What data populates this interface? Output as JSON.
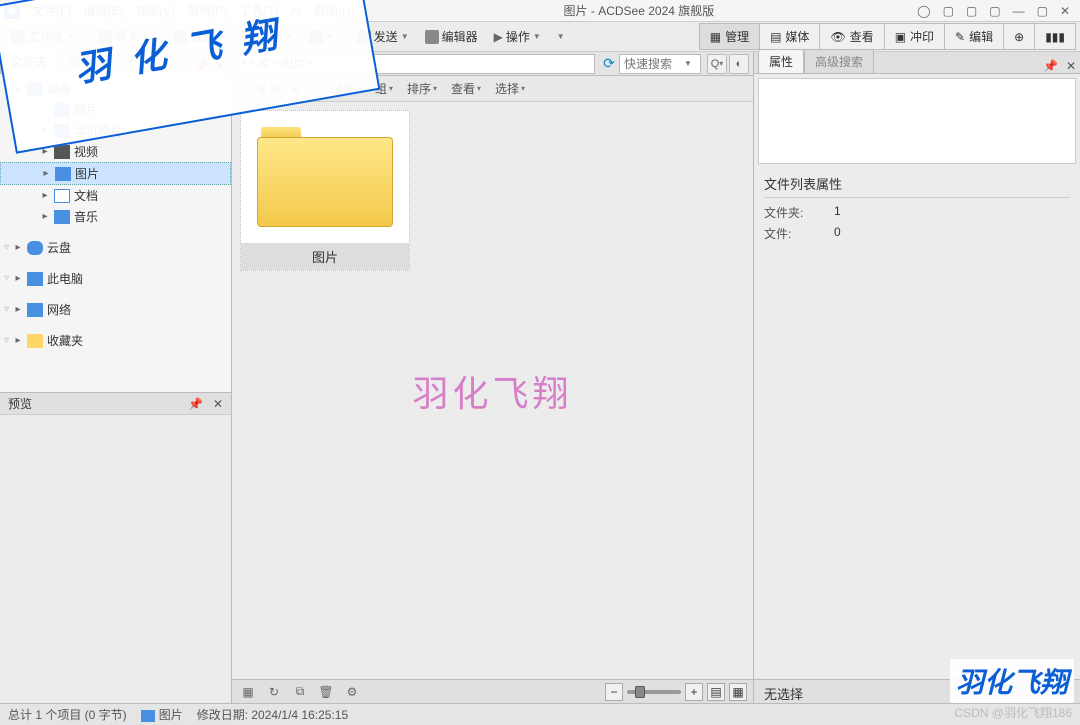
{
  "app": {
    "title": "图片 - ACDSee 2024 旗舰版"
  },
  "menu": {
    "file": "文件(F)",
    "edit": "编辑(E)",
    "view": "视图(V)",
    "pane": "窗格(P)",
    "tools": "工具(T)",
    "ai": "AI",
    "help": "帮助(H)"
  },
  "toolbar": {
    "workspace": "工作区",
    "import": "导入",
    "batch": "批量",
    "create": "创建",
    "send": "发送",
    "editor": "编辑器",
    "operate": "操作"
  },
  "modes": {
    "manage": "管理",
    "media": "媒体",
    "view": "查看",
    "develop": "冲印",
    "edit": "编辑"
  },
  "leftTabs": {
    "folder": "文件夹",
    "catalog": "编目",
    "calendar": "日历"
  },
  "tree": {
    "desktop": "桌面",
    "photos": "本机照片",
    "video": "视频",
    "pictures": "图片",
    "documents": "文档",
    "music": "音乐",
    "cloud": "云盘",
    "thispc": "此电脑",
    "network": "网络",
    "favorites": "收藏夹",
    "picsub": "图片"
  },
  "preview": {
    "title": "预览"
  },
  "breadcrumb": {
    "lib": "库",
    "pics": "图片"
  },
  "search": {
    "placeholder": "快速搜索"
  },
  "viewbar": {
    "filter": "过滤",
    "group": "组",
    "sort": "排序",
    "view": "查看",
    "select": "选择"
  },
  "thumb": {
    "label": "图片"
  },
  "rightTabs": {
    "props": "属性",
    "advsearch": "高级搜索"
  },
  "props": {
    "header": "文件列表属性",
    "foldersK": "文件夹:",
    "foldersV": "1",
    "filesK": "文件:",
    "filesV": "0"
  },
  "rightFooter": {
    "nosel": "无选择"
  },
  "status": {
    "total": "总计 1 个项目 (0 字节)",
    "sel": "图片",
    "modified": "修改日期: 2024/1/4 16:25:15"
  },
  "watermark": {
    "center": "羽化飞翔",
    "diag": "羽化飞翔",
    "corner": "羽化飞翔",
    "csdn": "CSDN @羽化飞翔186"
  }
}
